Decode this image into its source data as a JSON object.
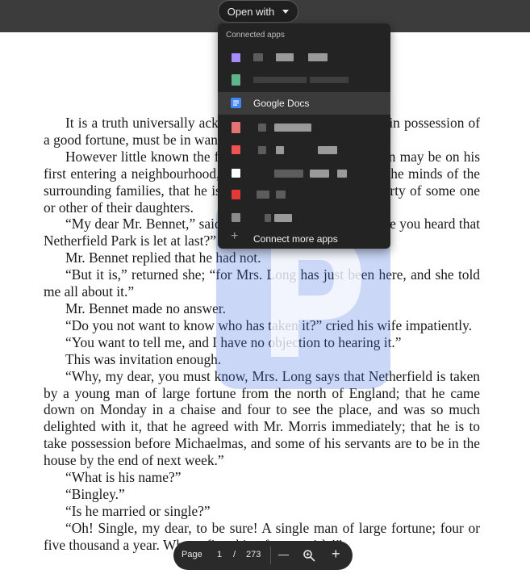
{
  "toolbar": {
    "open_with_label": "Open with"
  },
  "menu": {
    "header": "Connected apps",
    "google_docs_label": "Google Docs",
    "connect_more_label": "Connect more apps",
    "icon_colors": [
      "#a78bfa",
      "#5fb58a",
      "#4285f4",
      "#e57373",
      "#ef5350",
      "#ffffff",
      "#e53935",
      "#8a8a8a"
    ]
  },
  "book": {
    "paragraphs": [
      "It is a truth universally acknowledged, that a single man in possession of a good fortune, must be in want of a wife.",
      "However little known the feelings or views of such a man may be on his first entering a neighbourhood, this truth is so well fixed in the minds of the surrounding families, that he is considered the rightful property of some one or other of their daughters.",
      "“My dear Mr. Bennet,” said his lady to him one day, “have you heard that Netherfield Park is let at last?”",
      "Mr. Bennet replied that he had not.",
      "“But it is,” returned she; “for Mrs. Long has just been here, and she told me all about it.”",
      "Mr. Bennet made no answer.",
      "“Do you not want to know who has taken it?” cried his wife impatiently.",
      "“You want to tell me, and I have no objection to hearing it.”",
      "This was invitation enough.",
      "“Why, my dear, you must know, Mrs. Long says that Netherfield is taken by a young man of large fortune from the north of England; that he came down on Monday in a chaise and four to see the place, and was so much delighted with it, that he agreed with Mr. Morris immediately; that he is to take possession before Michaelmas, and some of his servants are to be in the house by the end of next week.”",
      "“What is his name?”",
      "“Bingley.”",
      "“Is he married or single?”",
      "“Oh! Single, my dear, to be sure! A single man of large fortune; four or five thousand a year. What a fine thing for our girls!”"
    ]
  },
  "pagebar": {
    "page_label": "Page",
    "current_page": "1",
    "separator": "/",
    "total_pages": "273",
    "zoom_out": "—",
    "zoom_in": "+"
  }
}
